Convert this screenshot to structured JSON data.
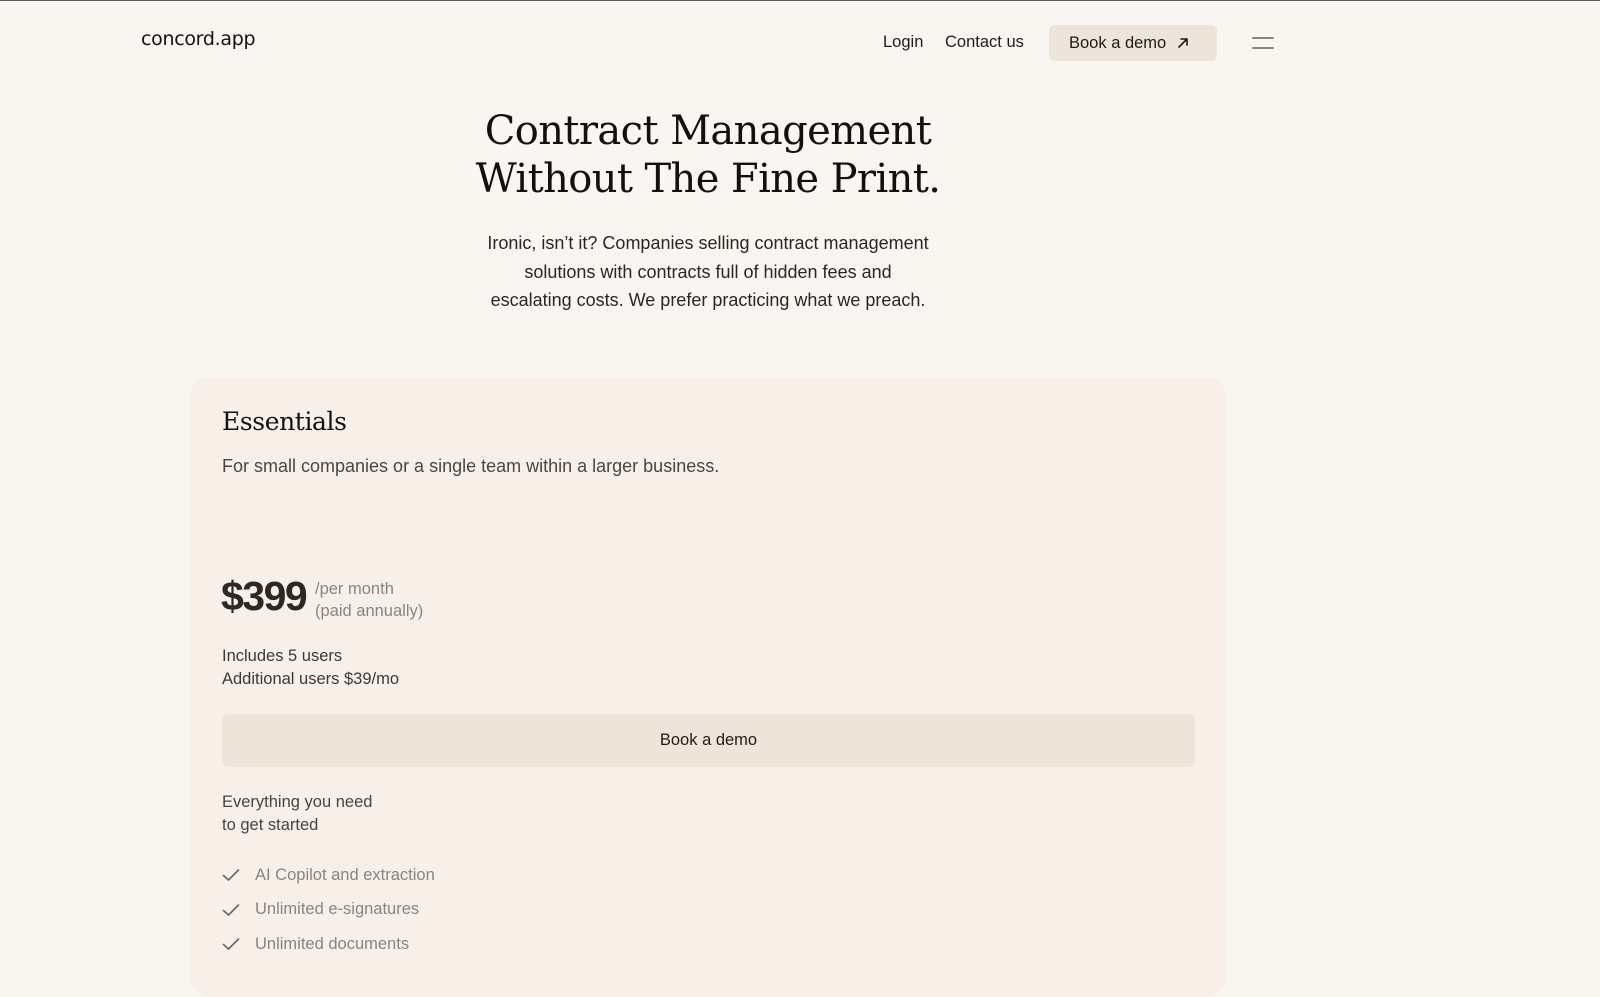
{
  "header": {
    "logo": "concord.app",
    "nav": {
      "login": "Login",
      "contact": "Contact us",
      "demo": "Book a demo"
    }
  },
  "hero": {
    "title_line1": "Contract Management",
    "title_line2": "Without The Fine Print.",
    "subtitle_line1": "Ironic, isn’t it? Companies selling contract management",
    "subtitle_line2": "solutions with contracts full of hidden fees and",
    "subtitle_line3": "escalating costs. We prefer practicing what we preach."
  },
  "plan": {
    "name": "Essentials",
    "description": "For small companies or a single team within a larger business.",
    "price": "$399",
    "period_line1": "/per month",
    "period_line2": "(paid annually)",
    "users_line1": "Includes 5 users",
    "users_line2": "Additional users $39/mo",
    "cta": "Book a demo",
    "features_heading_line1": "Everything you need",
    "features_heading_line2": "to get started",
    "features": [
      "AI Copilot and extraction",
      "Unlimited e-signatures",
      "Unlimited documents"
    ]
  },
  "icons": {
    "demo_arrow": "arrow-up-right-icon",
    "menu": "menu-icon",
    "check": "check-icon"
  },
  "colors": {
    "background": "#f9f6f1",
    "card": "#f7efe8",
    "button": "#ede4da",
    "text": "#1e1b19",
    "muted": "#8b847e"
  }
}
